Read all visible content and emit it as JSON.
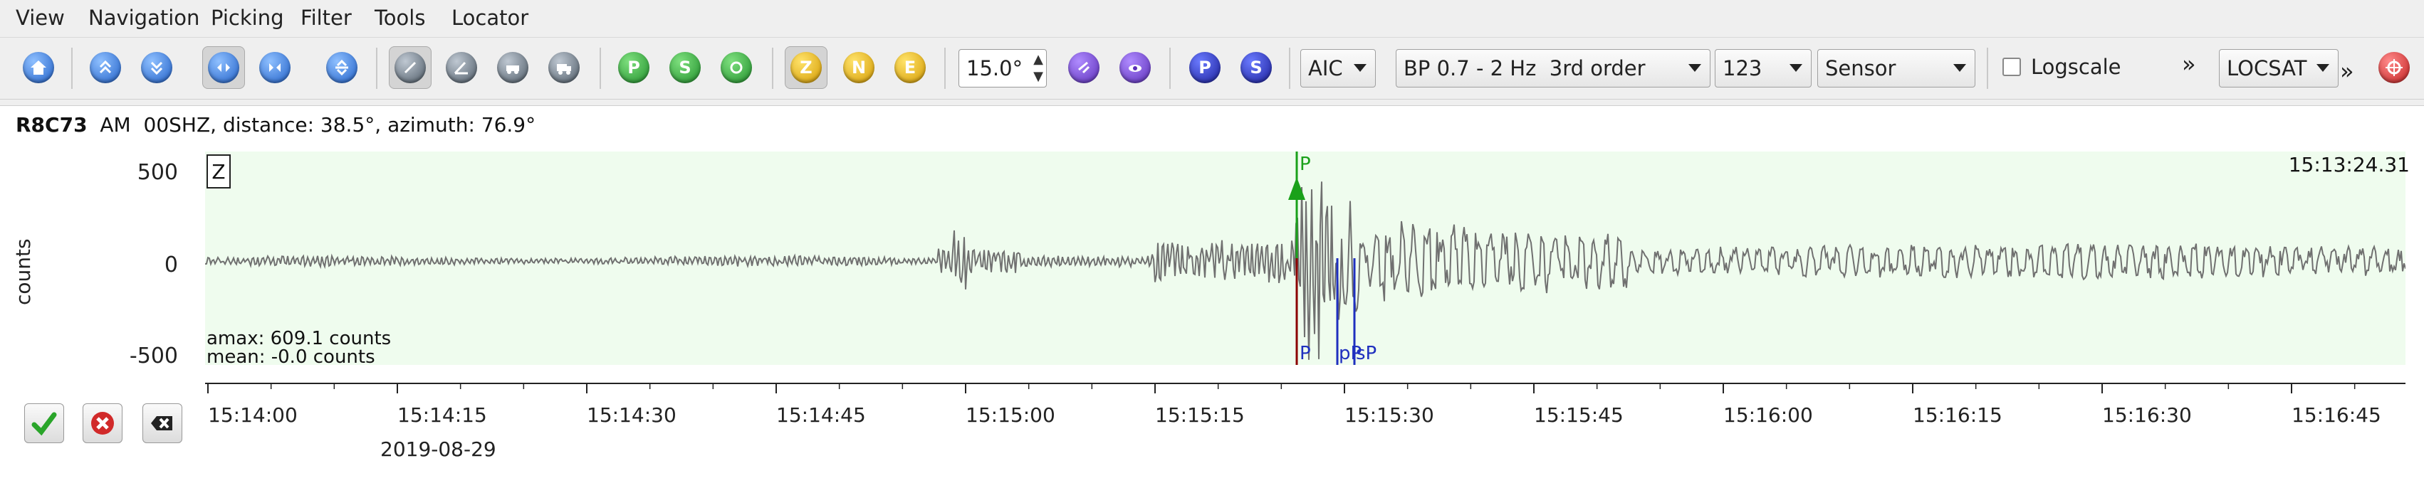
{
  "menu": {
    "items": [
      "View",
      "Navigation",
      "Picking",
      "Filter",
      "Tools",
      "Locator"
    ]
  },
  "toolbar": {
    "phase_buttons": [
      "Z",
      "N",
      "E"
    ],
    "angle_value": "15.0°",
    "picker_method": "AIC",
    "filter": "BP 0.7 - 2 Hz  3rd order",
    "counts_mode": "123",
    "unit_mode": "Sensor",
    "logscale_label": "Logscale",
    "logscale_checked": false,
    "overflow_glyph": "»",
    "locator": "LOCSAT",
    "pick_p_label": "P",
    "pick_s_label": "S"
  },
  "trace": {
    "station": "R8C73",
    "network": "AM",
    "channel_info": "00SHZ, distance: 38.5°, azimuth: 76.9°",
    "component": "Z",
    "y_axis_label": "counts",
    "y_ticks": [
      "500",
      "0",
      "-500"
    ],
    "timestamp": "15:13:24.31",
    "amax": "amax: 609.1 counts",
    "mean": "mean: -0.0 counts",
    "time_ticks": [
      "15:14:00",
      "15:14:15",
      "15:14:30",
      "15:14:45",
      "15:15:00",
      "15:15:15",
      "15:15:30",
      "15:15:45",
      "15:16:00",
      "15:16:15",
      "15:16:30",
      "15:16:45"
    ],
    "date": "2019-08-29",
    "picks": {
      "p_top": "P",
      "p_bottom": "P",
      "pp": "pP",
      "sp": "sP"
    }
  },
  "colors": {
    "plot_bg": "#effcee",
    "trace": "#707070",
    "pick_green": "#1aa11a",
    "pick_red": "#8b0000",
    "pick_blue": "#1f2fbf"
  }
}
